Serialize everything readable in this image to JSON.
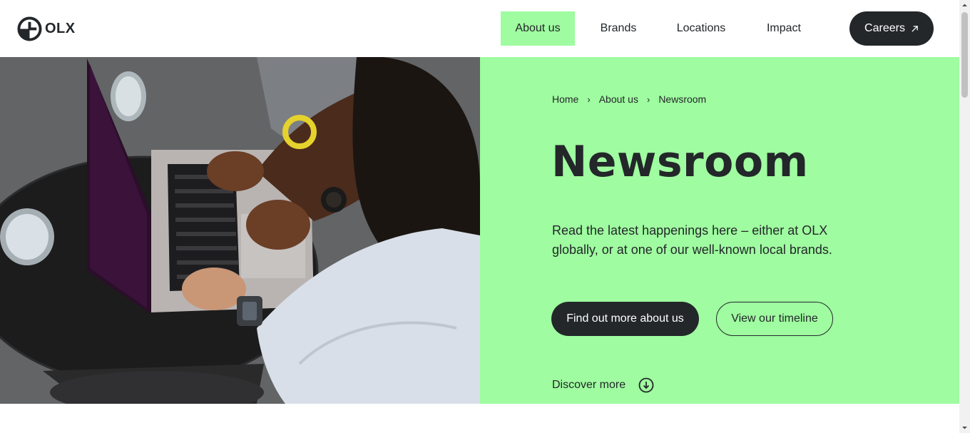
{
  "header": {
    "logo_text": "OLX",
    "nav": {
      "about": "About us",
      "brands": "Brands",
      "locations": "Locations",
      "impact": "Impact"
    },
    "careers_label": "Careers",
    "active_nav_color": "#9ffca0"
  },
  "hero": {
    "breadcrumb": [
      "Home",
      "About us",
      "Newsroom"
    ],
    "title": "Newsroom",
    "description": "Read the latest happenings here – either at OLX globally, or at one of our well-known local brands.",
    "primary_button": "Find out more about us",
    "secondary_button": "View our timeline",
    "discover_label": "Discover more",
    "panel_color": "#9ffca0",
    "dark_color": "#23272a"
  },
  "icons": {
    "logo": "olx-logo-icon",
    "careers": "arrow-up-right-icon",
    "discover": "arrow-down-circle-icon",
    "breadcrumb_sep": "chevron-right-icon"
  }
}
